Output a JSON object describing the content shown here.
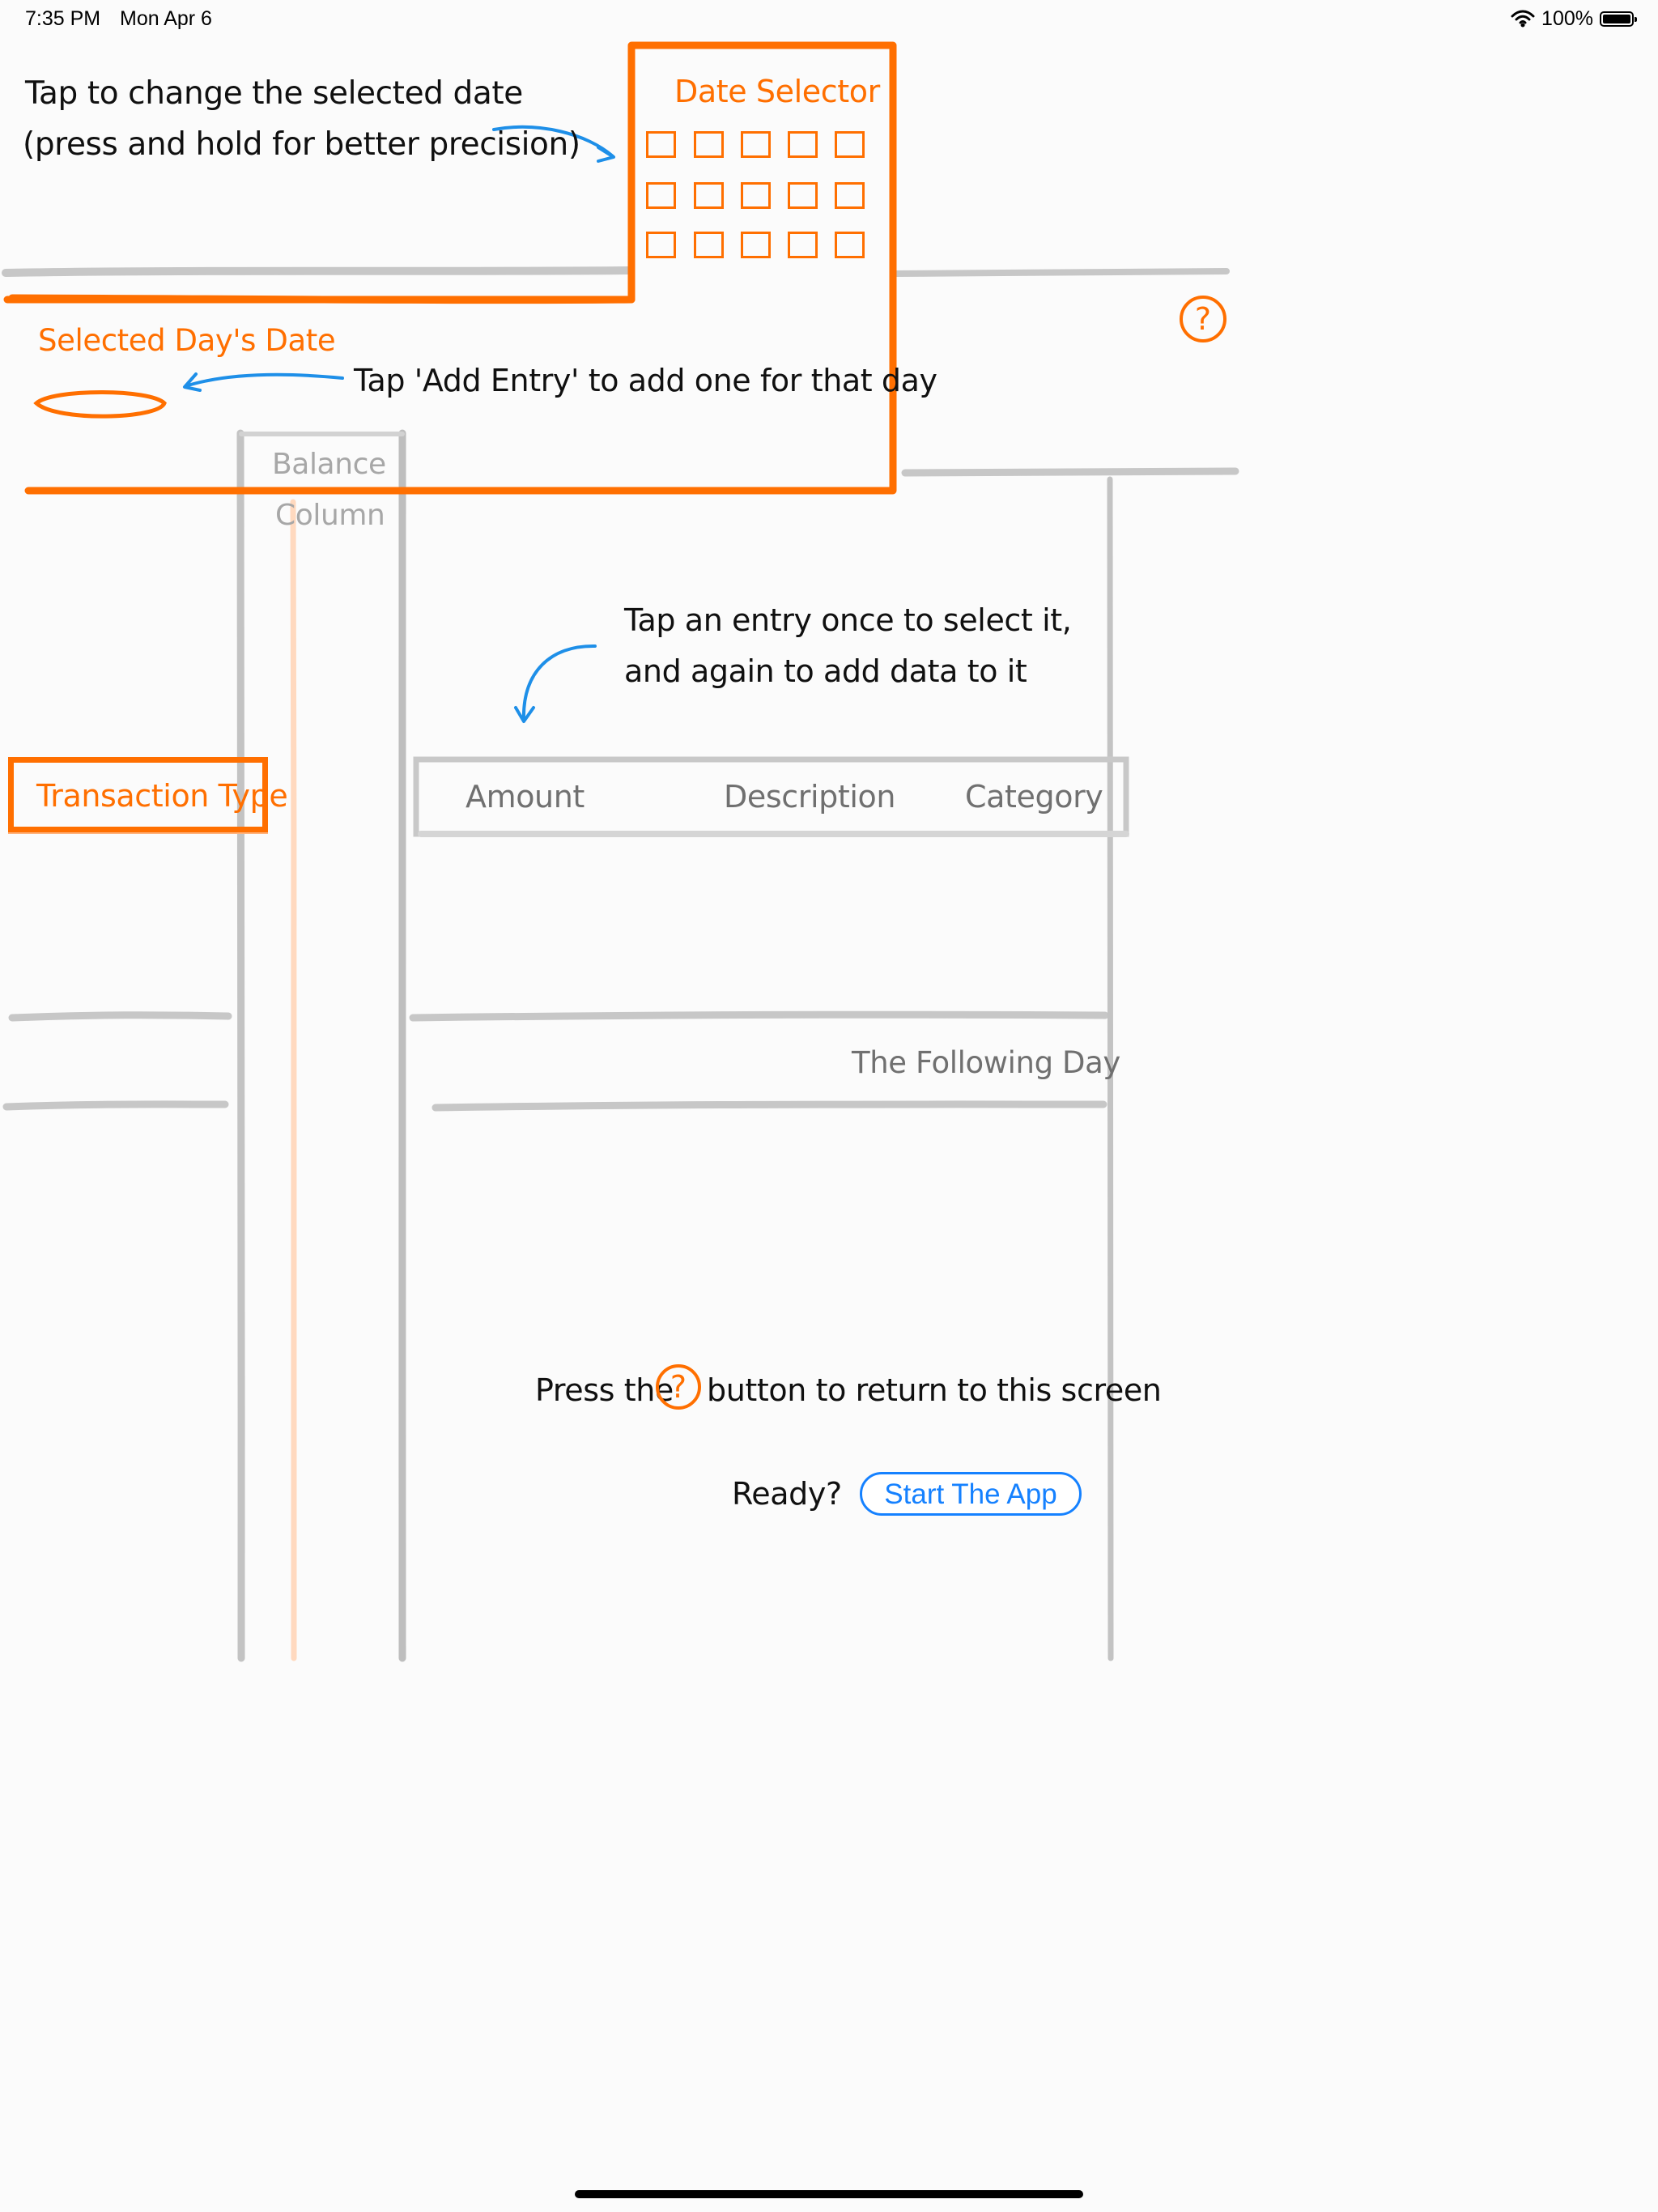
{
  "status_bar": {
    "time": "7:35 PM",
    "date": "Mon Apr 6",
    "battery": "100%",
    "wifi_icon": "wifi-icon",
    "battery_icon": "battery-icon"
  },
  "tutorial": {
    "date_instruction_line1": "Tap to change the selected date",
    "date_instruction_line2": "(press and hold for better precision)",
    "date_selector_label": "Date Selector",
    "selected_day_label": "Selected Day's Date",
    "add_entry_instruction": "Tap 'Add Entry' to add one for that day",
    "balance_label_line1": "Balance",
    "balance_label_line2": "Column",
    "entry_instruction_line1": "Tap an entry once to select it,",
    "entry_instruction_line2": "and again to add data to it",
    "transaction_type_label": "Transaction Type",
    "following_day_label": "The Following Day",
    "return_prefix": "Press the",
    "help_glyph": "?",
    "return_suffix": "button to return to this screen",
    "ready_label": "Ready?",
    "start_button": "Start The App"
  },
  "table": {
    "columns": [
      "Amount",
      "Description",
      "Category"
    ]
  },
  "colors": {
    "accent": "#ff6f00",
    "link": "#1581ff",
    "gray_line": "#c8c8c8",
    "background": "#fbfbfb"
  },
  "icons": {
    "help": "question-circle-icon",
    "arrow_to_calendar": "curved-arrow-icon",
    "arrow_to_date": "left-arrow-icon",
    "arrow_to_entry": "down-arrow-icon"
  }
}
